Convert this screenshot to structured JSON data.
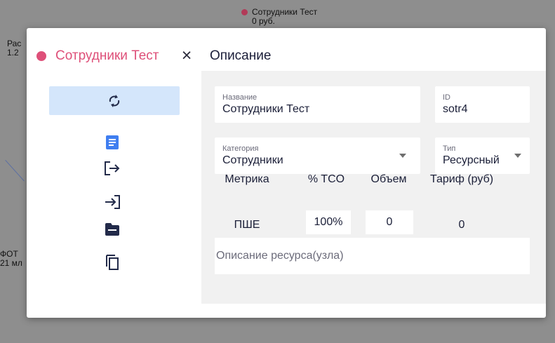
{
  "background": {
    "top_node": {
      "title": "Сотрудники Тест",
      "value": "0 руб."
    },
    "left_top_node": {
      "title": "Рас",
      "value": "1.2"
    },
    "left_bottom_node": {
      "title": "ФОТ",
      "value": "21 мл"
    }
  },
  "modal": {
    "node_name": "Сотрудники Тест",
    "close_label": "×",
    "section_title": "Описание",
    "sidebar_icons": [
      "sync-icon",
      "document-icon",
      "output-icon",
      "input-icon",
      "folder-icon",
      "copy-icon"
    ]
  },
  "form": {
    "name": {
      "label": "Название",
      "value": "Сотрудники Тест"
    },
    "id": {
      "label": "ID",
      "value": "sotr4"
    },
    "category": {
      "label": "Категория",
      "value": "Сотрудники"
    },
    "type": {
      "label": "Тип",
      "value": "Ресурсный"
    },
    "metrics_table": {
      "headers": [
        "Метрика",
        "% TCO",
        "Объем",
        "Тариф (руб)"
      ],
      "row": {
        "metric": "ПШЕ",
        "tco": "100%",
        "volume": "0",
        "tariff": "0"
      }
    },
    "description_placeholder": "Описание ресурса(узла)"
  },
  "colors": {
    "accent_pink": "#de5079",
    "sync_bg": "#d4e6fb",
    "doc_icon_blue": "#3f7ef0",
    "panel_bg": "#f1f1f1",
    "backdrop": "#8e8e8e"
  }
}
